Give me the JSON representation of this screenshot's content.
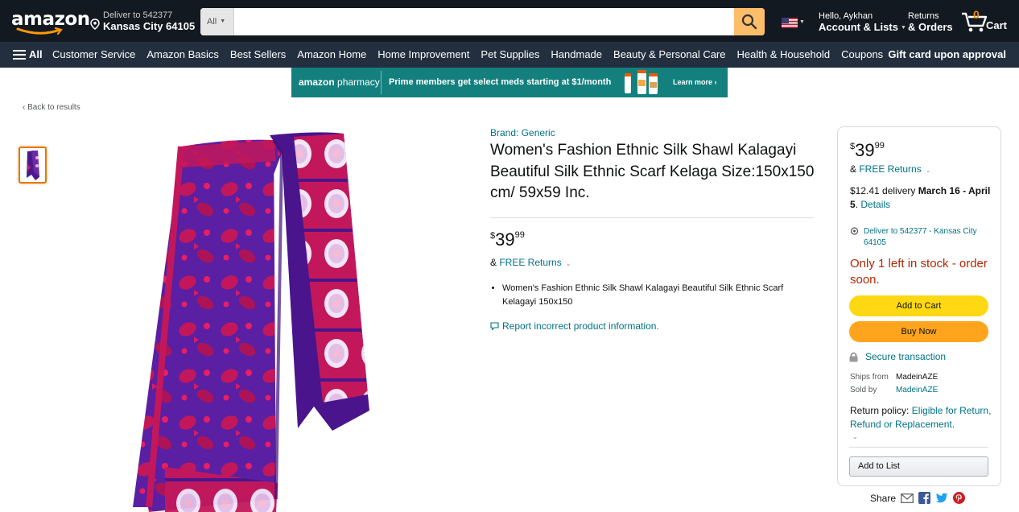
{
  "header": {
    "logo_text": "amazon",
    "deliver_line1": "Deliver to 542377",
    "deliver_line2": "Kansas City 64105",
    "search_category": "All",
    "search_placeholder": "",
    "account_line1": "Hello, Aykhan",
    "account_line2": "Account & Lists",
    "orders_line1": "Returns",
    "orders_line2": "& Orders",
    "cart_count": "0",
    "cart_label": "Cart"
  },
  "nav": {
    "all_label": "All",
    "items": [
      "Customer Service",
      "Amazon Basics",
      "Best Sellers",
      "Amazon Home",
      "Home Improvement",
      "Pet Supplies",
      "Handmade",
      "Beauty & Personal Care",
      "Health & Household",
      "Coupons"
    ],
    "right_label": "Gift card upon approval"
  },
  "banner": {
    "brand_a": "amazon",
    "brand_b": " pharmacy",
    "message": "Prime members get select meds starting at $1/month",
    "learn_more": "Learn more ›"
  },
  "back_link": "‹ Back to results",
  "product": {
    "brand": "Brand: Generic",
    "title": "Women's Fashion Ethnic Silk Shawl Kalagayi Beautiful Silk Ethnic Scarf Kelaga Size:150x150 cm/ 59x59 Inc.",
    "price_symbol": "$",
    "price_whole": "39",
    "price_fraction": "99",
    "free_prefix": "& ",
    "free_returns": "FREE Returns",
    "bullets": [
      "Women's Fashion Ethnic Silk Shawl Kalagayi Beautiful Silk Ethnic Scarf Kelagayi 150x150"
    ],
    "report": "Report incorrect product information."
  },
  "buybox": {
    "price_symbol": "$",
    "price_whole": "39",
    "price_fraction": "99",
    "free_prefix": "& ",
    "free_returns": "FREE Returns",
    "delivery_prefix": "$12.41 delivery ",
    "delivery_dates": "March 16 - April 5",
    "delivery_suffix": ". ",
    "delivery_details": "Details",
    "deliver_to": "Deliver to 542377 - Kansas City 64105",
    "stock": "Only 1 left in stock - order soon.",
    "add_to_cart": "Add to Cart",
    "buy_now": "Buy Now",
    "secure": "Secure transaction",
    "ships_from_label": "Ships from",
    "ships_from_value": "MadeinAZE",
    "sold_by_label": "Sold by",
    "sold_by_value": "MadeinAZE",
    "return_label": "Return policy: ",
    "return_value": "Eligible for Return, Refund or Replacement.",
    "add_to_list": "Add to List"
  },
  "share_label": "Share",
  "colors": {
    "header_bg": "#131921",
    "nav_bg": "#232f3e",
    "search_btn": "#febd69",
    "link": "#007185",
    "stock": "#b12704",
    "add_to_cart": "#ffd814",
    "buy_now": "#ffa41c",
    "banner": "#13807e"
  }
}
